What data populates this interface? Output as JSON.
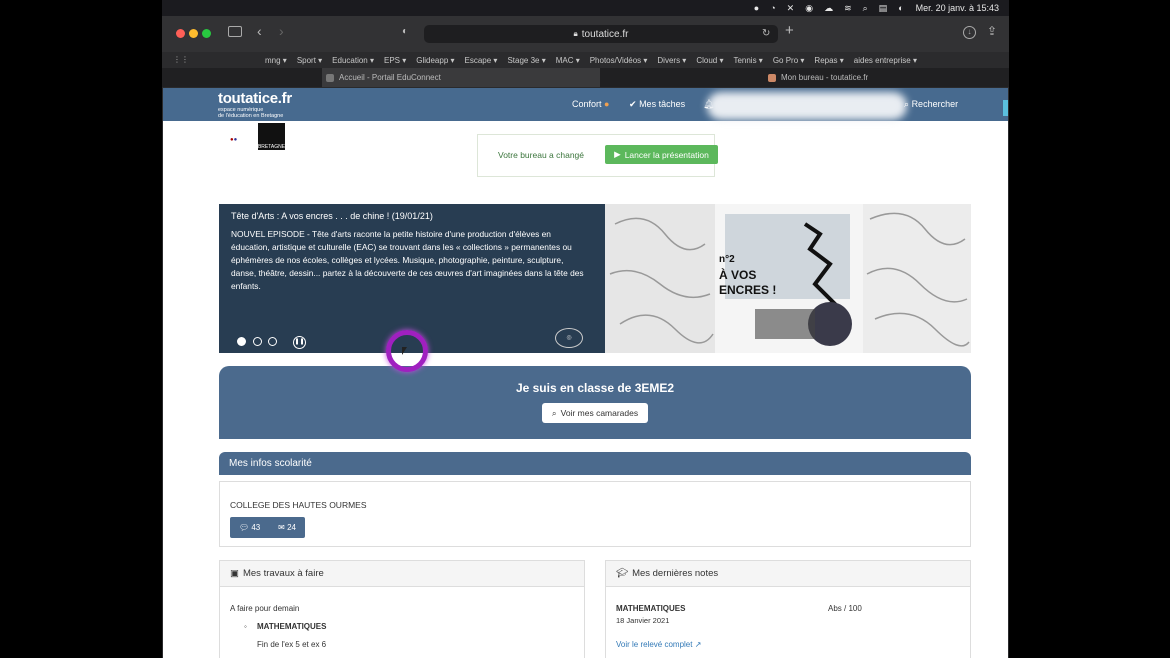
{
  "menubar": {
    "datetime": "Mer. 20 janv. à  15:43"
  },
  "browser": {
    "url": "toutatice.fr",
    "bookmarks": [
      "mng ▾",
      "Sport ▾",
      "Education ▾",
      "EPS ▾",
      "Glideapp ▾",
      "Escape ▾",
      "Stage 3e ▾",
      "MAC ▾",
      "Photos/Vidéos ▾",
      "Divers ▾",
      "Cloud ▾",
      "Tennis ▾",
      "Go Pro ▾",
      "Repas ▾",
      "aides entreprise ▾"
    ],
    "tabs": [
      {
        "label": "Accueil - Portail EduConnect"
      },
      {
        "label": "Mon bureau - toutatice.fr"
      }
    ]
  },
  "site": {
    "logo_title": "toutatice.fr",
    "logo_sub1": "espace numérique",
    "logo_sub2": "de l'éducation en Bretagne",
    "nav": {
      "confort": "Confort",
      "taches": "Mes tâches",
      "search": "Rechercher"
    },
    "region_logo": "BRETAGNE"
  },
  "notice": {
    "text": "Votre bureau a changé",
    "button": "Lancer la présentation"
  },
  "carousel": {
    "title": "Tête d'Arts : A vos encres . . . de chine ! (19/01/21)",
    "text": "NOUVEL EPISODE - Tête d'arts raconte la petite histoire d'une production d'élèves en éducation, artistique et culturelle (EAC) se trouvant dans les « collections » permanentes ou éphémères de nos écoles, collèges et lycées. Musique, photographie, peinture, sculpture, danse, théâtre, dessin... partez à la découverte de ces œuvres d'art imaginées dans la tête des enfants.",
    "image_text": "n°2 À VOS ENCRES !"
  },
  "classe": {
    "title": "Je suis en classe de 3EME2",
    "button": "Voir mes camarades"
  },
  "infos": {
    "title": "Mes infos scolarité",
    "college": "COLLEGE DES HAUTES OURMES",
    "messages": "43",
    "mails": "24"
  },
  "travaux": {
    "title": "Mes travaux à faire",
    "due": "A faire pour demain",
    "subject": "MATHEMATIQUES",
    "task": "Fin de l'ex 5 et ex 6"
  },
  "notes": {
    "title": "Mes dernières notes",
    "subject": "MATHEMATIQUES",
    "date": "18 Janvier 2021",
    "score": "Abs / 100",
    "link": "Voir le relevé complet"
  },
  "colors": {
    "header": "#476a8f",
    "panel": "#4b6a8d",
    "success": "#5cb85c",
    "caption": "#283d52"
  }
}
